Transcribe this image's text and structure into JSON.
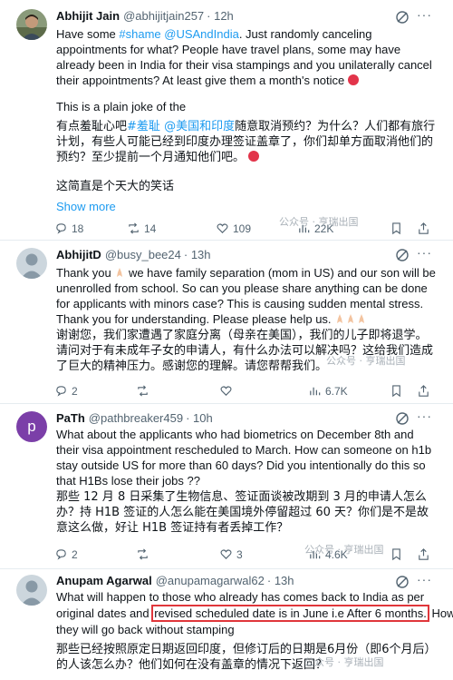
{
  "tweets": [
    {
      "name": "Abhijit Jain",
      "handle": "@abhijitjain257",
      "time": "· 12h",
      "text1": "Have some ",
      "hashtag": "#shame",
      "mention": "@USAndIndia",
      "text2": ". Just randomly canceling appointments for what? People have travel plans, some may have already been in India for their visa stampings and you unilaterally cancel their appointments? At least give them a month's notice",
      "text3": "This is a plain joke of the",
      "cn1_a": "有点羞耻心吧",
      "cn1_tag": "#羞耻",
      "cn1_mention": "@美国和印度",
      "cn1_b": "随意取消预约？为什么？人们都有旅行计划，有些人可能已经到印度办理签证盖章了，你们却单方面取消他们的预约？至少提前一个月通知他们吧。",
      "cn2": "这简直是个天大的笑话",
      "show_more": "Show more",
      "replies": "18",
      "retweets": "14",
      "likes": "109",
      "views": "22K"
    },
    {
      "name": "AbhijitD",
      "handle": "@busy_bee24",
      "time": "· 13h",
      "text1": "Thank you",
      "text2": " we have family separation (mom in US) and our son will be unenrolled from school. So can you please share anything can be done for applicants with minors case? This is causing sudden mental stress. Thank you for understanding. Please please help us.",
      "cn1": "谢谢您，我们家遭遇了家庭分离（母亲在美国），我们的儿子即将退学。请问对于有未成年子女的申请人，有什么办法可以解决吗？这给我们造成了巨大的精神压力。感谢您的理解。请您帮帮我们。",
      "replies": "2",
      "retweets": "",
      "likes": "",
      "views": "6.7K"
    },
    {
      "name": "PaTh",
      "handle": "@pathbreaker459",
      "time": "· 10h",
      "avatar_letter": "p",
      "text": "What about the applicants who had biometrics on December 8th and their visa appointment rescheduled to March. How can someone on h1b stay outside US for more than 60 days? Did you intentionally do this so that H1Bs lose their jobs ??",
      "cn1": "那些 12 月 8 日采集了生物信息、签证面谈被改期到 3 月的申请人怎么办？持 H1B 签证的人怎么能在美国境外停留超过 60 天？你们是不是故意这么做，好让 H1B 签证持有者丢掉工作？",
      "replies": "2",
      "retweets": "",
      "likes": "3",
      "views": "4.6K"
    },
    {
      "name": "Anupam Agarwal",
      "handle": "@anupamagarwal62",
      "time": "· 13h",
      "line1": "What will happen to those who already has comes back to India as per",
      "line2a": "original dates and ",
      "line2hl": "revised scheduled date is in June i.e After 6 months.",
      "line2b": " How",
      "line3": "they will go back without stamping",
      "cn1": "那些已经按照原定日期返回印度，但修订后的日期是6月份（即6个月后）的人该怎么办？他们如何在没有盖章的情况下返回？"
    }
  ],
  "watermark": "公众号 · 亨瑞出国",
  "colors": {
    "link": "#1d9bf0",
    "highlight": "#e0363b",
    "text": "#0f1419",
    "muted": "#536471"
  }
}
